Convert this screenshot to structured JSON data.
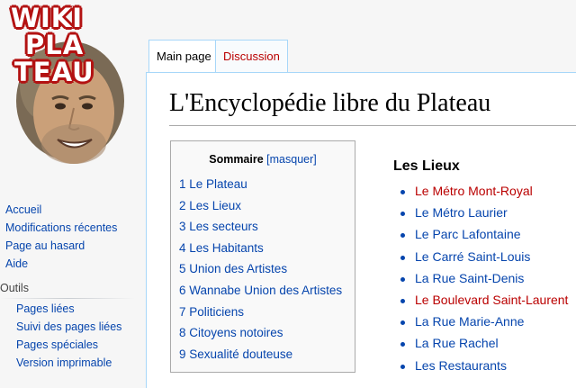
{
  "logo": {
    "line1": "WIKI",
    "line2": "PLA",
    "line3": "TEAU"
  },
  "tabs": [
    {
      "label": "Main page"
    },
    {
      "label": "Discussion"
    }
  ],
  "page_title": "L'Encyclopédie libre du Plateau",
  "toc": {
    "title": "Sommaire",
    "toggle": "[masquer]",
    "items": [
      "1 Le Plateau",
      "2 Les Lieux",
      "3 Les secteurs",
      "4 Les Habitants",
      "5 Union des Artistes",
      "6 Wannabe Union des Artistes",
      "7 Politiciens",
      "8 Citoyens notoires",
      "9 Sexualité douteuse"
    ]
  },
  "lieux": {
    "heading": "Les Lieux",
    "items": [
      {
        "label": "Le Métro Mont-Royal",
        "color": "#ba0000"
      },
      {
        "label": "Le Métro Laurier",
        "color": "#0645ad"
      },
      {
        "label": "Le Parc Lafontaine",
        "color": "#0645ad"
      },
      {
        "label": "Le Carré Saint-Louis",
        "color": "#0645ad"
      },
      {
        "label": "La Rue Saint-Denis",
        "color": "#0645ad"
      },
      {
        "label": "Le Boulevard Saint-Laurent",
        "color": "#ba0000"
      },
      {
        "label": "La Rue Marie-Anne",
        "color": "#0645ad"
      },
      {
        "label": "La Rue Rachel",
        "color": "#0645ad"
      },
      {
        "label": "Les Restaurants",
        "color": "#0645ad"
      }
    ]
  },
  "sidebar": {
    "nav": [
      "Accueil",
      "Modifications récentes",
      "Page au hasard",
      "Aide"
    ],
    "tools_label": "Outils",
    "tools": [
      "Pages liées",
      "Suivi des pages liées",
      "Pages spéciales",
      "Version imprimable"
    ]
  },
  "colors": {
    "link": "#0645ad",
    "redlink": "#ba0000",
    "tab_border": "#a7d7f9"
  }
}
